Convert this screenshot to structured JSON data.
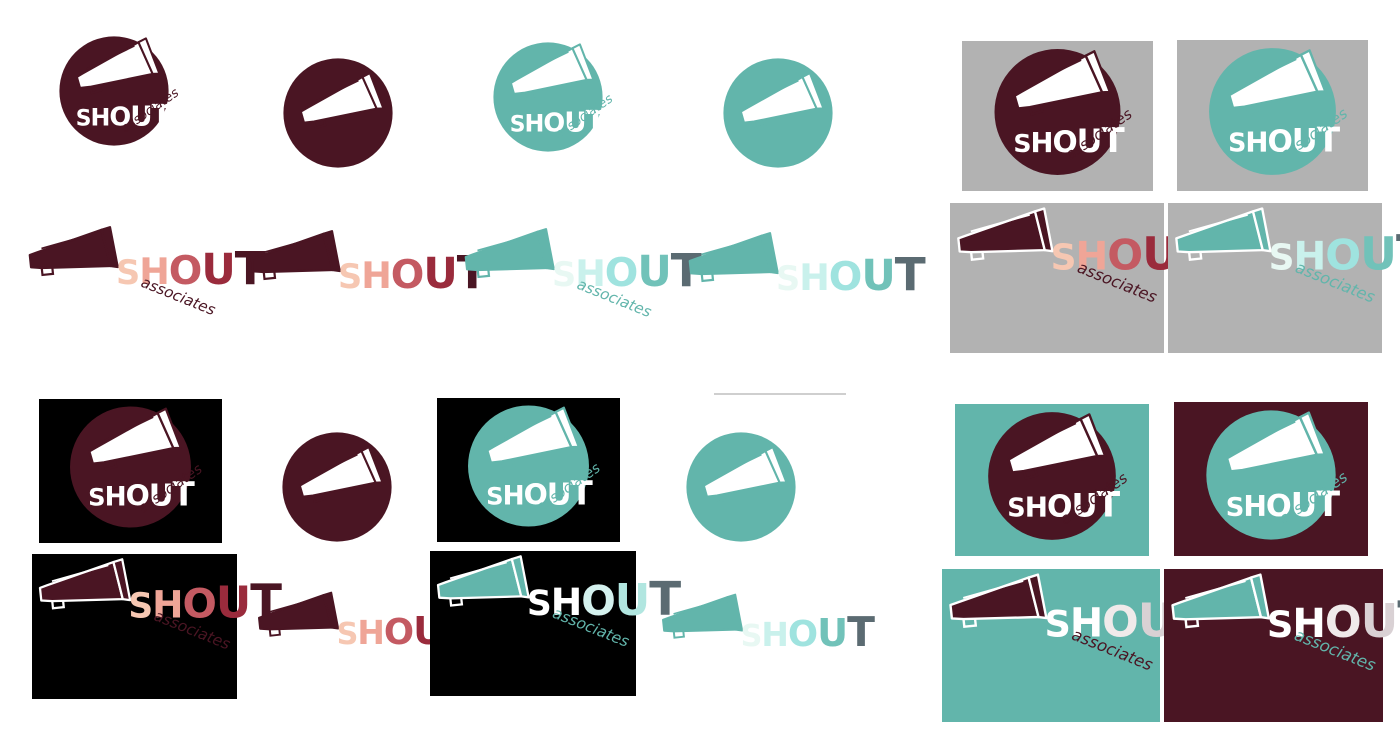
{
  "brand": {
    "word": "SHOUT",
    "sub": "associates",
    "letters": [
      "S",
      "H",
      "O",
      "U",
      "T"
    ]
  },
  "colors": {
    "maroon": "#4a1523",
    "teal": "#62b5ab",
    "grey": "#b2b2b2",
    "black": "#000000",
    "white": "#ffffff",
    "slate": "#5b6b72",
    "maroon_wordmark": [
      "#f6c7b2",
      "#efa597",
      "#c45a62",
      "#9a2b3c",
      "#4a1523"
    ],
    "teal_wordmark": [
      "#e8f8f3",
      "#c9f1ec",
      "#9fe3df",
      "#71c2b9",
      "#5b6b72"
    ],
    "teal_wordmark_on_black": [
      "#ffffff",
      "#ffffff",
      "#d4f1ee",
      "#b1e6e0",
      "#5b6b72"
    ],
    "light_wordmark": [
      "#ffffff",
      "#ffffff",
      "#f0eaea",
      "#d9d1d4",
      "#5b6b72"
    ]
  },
  "icons": {
    "logo_mark": "megaphone-icon"
  },
  "variants": [
    {
      "id": "a",
      "type": "round",
      "bg": "none",
      "circle": "maroon",
      "text": true,
      "sub": "maroon"
    },
    {
      "id": "b",
      "type": "round",
      "bg": "none",
      "circle": "maroon",
      "text": false
    },
    {
      "id": "c",
      "type": "round",
      "bg": "none",
      "circle": "teal",
      "text": true,
      "sub": "teal"
    },
    {
      "id": "d",
      "type": "round",
      "bg": "none",
      "circle": "teal",
      "text": false
    },
    {
      "id": "e",
      "type": "horizontal",
      "bg": "none",
      "mega": "maroon",
      "word": "maroon_wordmark",
      "sub": "maroon"
    },
    {
      "id": "f",
      "type": "horizontal",
      "bg": "none",
      "mega": "maroon",
      "word": "maroon_wordmark",
      "sub": null
    },
    {
      "id": "g",
      "type": "horizontal",
      "bg": "none",
      "mega": "teal",
      "word": "teal_wordmark",
      "sub": "teal"
    },
    {
      "id": "h",
      "type": "horizontal",
      "bg": "none",
      "mega": "teal",
      "word": "teal_wordmark",
      "sub": null
    },
    {
      "id": "i",
      "type": "round",
      "bg": "grey",
      "circle": "maroon",
      "text": true,
      "sub": "maroon"
    },
    {
      "id": "j",
      "type": "round",
      "bg": "grey",
      "circle": "teal",
      "text": true,
      "sub": "teal"
    },
    {
      "id": "k",
      "type": "horizontal",
      "bg": "grey",
      "mega": "maroon",
      "word": "maroon_wordmark",
      "sub": "maroon"
    },
    {
      "id": "l",
      "type": "horizontal",
      "bg": "grey",
      "mega": "teal",
      "word": "teal_wordmark",
      "sub": "teal"
    },
    {
      "id": "m",
      "type": "round",
      "bg": "black",
      "circle": "maroon",
      "text": true,
      "sub": "maroon"
    },
    {
      "id": "n",
      "type": "round",
      "bg": "none",
      "circle": "maroon",
      "text": false
    },
    {
      "id": "o",
      "type": "round",
      "bg": "black",
      "circle": "teal",
      "text": true,
      "sub": "teal"
    },
    {
      "id": "p",
      "type": "round",
      "bg": "none",
      "circle": "teal",
      "text": false
    },
    {
      "id": "q",
      "type": "horizontal",
      "bg": "black",
      "mega": "maroon",
      "word": "maroon_wordmark",
      "sub": "maroon"
    },
    {
      "id": "r",
      "type": "horizontal",
      "bg": "none",
      "mega": "maroon",
      "word": "maroon_wordmark",
      "sub": null
    },
    {
      "id": "s",
      "type": "horizontal",
      "bg": "black",
      "mega": "teal",
      "word": "teal_wordmark_on_black",
      "sub": "teal"
    },
    {
      "id": "t",
      "type": "horizontal",
      "bg": "none",
      "mega": "teal",
      "word": "teal_wordmark",
      "sub": null
    },
    {
      "id": "u",
      "type": "round",
      "bg": "teal",
      "circle": "maroon",
      "text": true,
      "sub": "maroon"
    },
    {
      "id": "v",
      "type": "round",
      "bg": "maroon",
      "circle": "teal",
      "text": true,
      "sub": "teal"
    },
    {
      "id": "w",
      "type": "horizontal",
      "bg": "teal",
      "mega": "maroon",
      "word": "light_wordmark",
      "sub": "maroon"
    },
    {
      "id": "x",
      "type": "horizontal",
      "bg": "maroon",
      "mega": "teal",
      "word": "light_wordmark",
      "sub": "teal"
    }
  ]
}
